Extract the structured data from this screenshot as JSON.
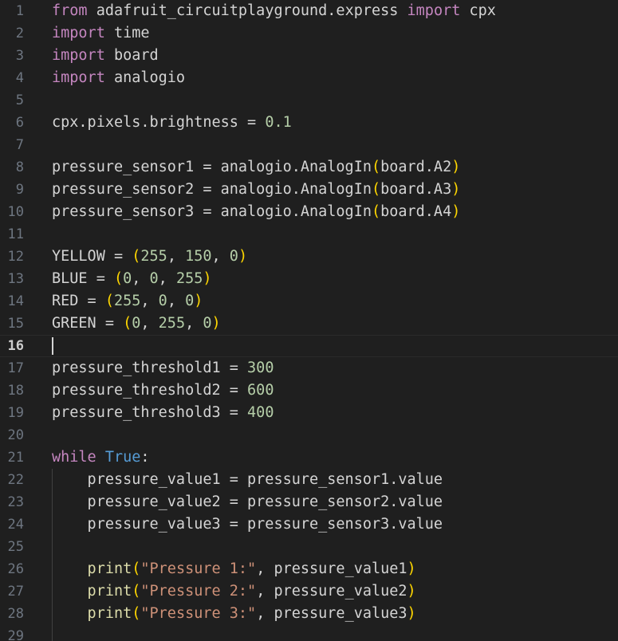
{
  "editor": {
    "language": "python",
    "current_line": 16,
    "lines": [
      {
        "n": "1",
        "tokens": [
          {
            "t": "from",
            "c": "t-kw"
          },
          {
            "t": " adafruit_circuitplayground.express ",
            "c": "t-var"
          },
          {
            "t": "import",
            "c": "t-kw"
          },
          {
            "t": " cpx",
            "c": "t-var"
          }
        ]
      },
      {
        "n": "2",
        "tokens": [
          {
            "t": "import",
            "c": "t-kw"
          },
          {
            "t": " time",
            "c": "t-var"
          }
        ]
      },
      {
        "n": "3",
        "tokens": [
          {
            "t": "import",
            "c": "t-kw"
          },
          {
            "t": " board",
            "c": "t-var"
          }
        ]
      },
      {
        "n": "4",
        "tokens": [
          {
            "t": "import",
            "c": "t-kw"
          },
          {
            "t": " analogio",
            "c": "t-var"
          }
        ]
      },
      {
        "n": "5",
        "tokens": []
      },
      {
        "n": "6",
        "tokens": [
          {
            "t": "cpx.pixels.brightness = ",
            "c": "t-var"
          },
          {
            "t": "0.1",
            "c": "t-num"
          }
        ]
      },
      {
        "n": "7",
        "tokens": []
      },
      {
        "n": "8",
        "tokens": [
          {
            "t": "pressure_sensor1 = analogio.AnalogIn",
            "c": "t-var"
          },
          {
            "t": "(",
            "c": "t-p1"
          },
          {
            "t": "board.A2",
            "c": "t-var"
          },
          {
            "t": ")",
            "c": "t-p1"
          }
        ]
      },
      {
        "n": "9",
        "tokens": [
          {
            "t": "pressure_sensor2 = analogio.AnalogIn",
            "c": "t-var"
          },
          {
            "t": "(",
            "c": "t-p1"
          },
          {
            "t": "board.A3",
            "c": "t-var"
          },
          {
            "t": ")",
            "c": "t-p1"
          }
        ]
      },
      {
        "n": "10",
        "tokens": [
          {
            "t": "pressure_sensor3 = analogio.AnalogIn",
            "c": "t-var"
          },
          {
            "t": "(",
            "c": "t-p1"
          },
          {
            "t": "board.A4",
            "c": "t-var"
          },
          {
            "t": ")",
            "c": "t-p1"
          }
        ]
      },
      {
        "n": "11",
        "tokens": []
      },
      {
        "n": "12",
        "tokens": [
          {
            "t": "YELLOW = ",
            "c": "t-var"
          },
          {
            "t": "(",
            "c": "t-p1"
          },
          {
            "t": "255",
            "c": "t-num"
          },
          {
            "t": ", ",
            "c": "t-var"
          },
          {
            "t": "150",
            "c": "t-num"
          },
          {
            "t": ", ",
            "c": "t-var"
          },
          {
            "t": "0",
            "c": "t-num"
          },
          {
            "t": ")",
            "c": "t-p1"
          }
        ]
      },
      {
        "n": "13",
        "tokens": [
          {
            "t": "BLUE = ",
            "c": "t-var"
          },
          {
            "t": "(",
            "c": "t-p1"
          },
          {
            "t": "0",
            "c": "t-num"
          },
          {
            "t": ", ",
            "c": "t-var"
          },
          {
            "t": "0",
            "c": "t-num"
          },
          {
            "t": ", ",
            "c": "t-var"
          },
          {
            "t": "255",
            "c": "t-num"
          },
          {
            "t": ")",
            "c": "t-p1"
          }
        ]
      },
      {
        "n": "14",
        "tokens": [
          {
            "t": "RED = ",
            "c": "t-var"
          },
          {
            "t": "(",
            "c": "t-p1"
          },
          {
            "t": "255",
            "c": "t-num"
          },
          {
            "t": ", ",
            "c": "t-var"
          },
          {
            "t": "0",
            "c": "t-num"
          },
          {
            "t": ", ",
            "c": "t-var"
          },
          {
            "t": "0",
            "c": "t-num"
          },
          {
            "t": ")",
            "c": "t-p1"
          }
        ]
      },
      {
        "n": "15",
        "tokens": [
          {
            "t": "GREEN = ",
            "c": "t-var"
          },
          {
            "t": "(",
            "c": "t-p1"
          },
          {
            "t": "0",
            "c": "t-num"
          },
          {
            "t": ", ",
            "c": "t-var"
          },
          {
            "t": "255",
            "c": "t-num"
          },
          {
            "t": ", ",
            "c": "t-var"
          },
          {
            "t": "0",
            "c": "t-num"
          },
          {
            "t": ")",
            "c": "t-p1"
          }
        ]
      },
      {
        "n": "16",
        "tokens": [],
        "cursor": true
      },
      {
        "n": "17",
        "tokens": [
          {
            "t": "pressure_threshold1 = ",
            "c": "t-var"
          },
          {
            "t": "300",
            "c": "t-num"
          }
        ]
      },
      {
        "n": "18",
        "tokens": [
          {
            "t": "pressure_threshold2 = ",
            "c": "t-var"
          },
          {
            "t": "600",
            "c": "t-num"
          }
        ]
      },
      {
        "n": "19",
        "tokens": [
          {
            "t": "pressure_threshold3 = ",
            "c": "t-var"
          },
          {
            "t": "400",
            "c": "t-num"
          }
        ]
      },
      {
        "n": "20",
        "tokens": []
      },
      {
        "n": "21",
        "tokens": [
          {
            "t": "while",
            "c": "t-ctl"
          },
          {
            "t": " ",
            "c": "t-var"
          },
          {
            "t": "True",
            "c": "t-const"
          },
          {
            "t": ":",
            "c": "t-var"
          }
        ]
      },
      {
        "n": "22",
        "indent": true,
        "tokens": [
          {
            "t": "    pressure_value1 = pressure_sensor1.value",
            "c": "t-var"
          }
        ]
      },
      {
        "n": "23",
        "indent": true,
        "tokens": [
          {
            "t": "    pressure_value2 = pressure_sensor2.value",
            "c": "t-var"
          }
        ]
      },
      {
        "n": "24",
        "indent": true,
        "tokens": [
          {
            "t": "    pressure_value3 = pressure_sensor3.value",
            "c": "t-var"
          }
        ]
      },
      {
        "n": "25",
        "indent": true,
        "tokens": []
      },
      {
        "n": "26",
        "indent": true,
        "tokens": [
          {
            "t": "    print",
            "c": "t-fn"
          },
          {
            "t": "(",
            "c": "t-p1"
          },
          {
            "t": "\"Pressure 1:\"",
            "c": "t-str"
          },
          {
            "t": ", pressure_value1",
            "c": "t-var"
          },
          {
            "t": ")",
            "c": "t-p1"
          }
        ]
      },
      {
        "n": "27",
        "indent": true,
        "tokens": [
          {
            "t": "    print",
            "c": "t-fn"
          },
          {
            "t": "(",
            "c": "t-p1"
          },
          {
            "t": "\"Pressure 2:\"",
            "c": "t-str"
          },
          {
            "t": ", pressure_value2",
            "c": "t-var"
          },
          {
            "t": ")",
            "c": "t-p1"
          }
        ]
      },
      {
        "n": "28",
        "indent": true,
        "tokens": [
          {
            "t": "    print",
            "c": "t-fn"
          },
          {
            "t": "(",
            "c": "t-p1"
          },
          {
            "t": "\"Pressure 3:\"",
            "c": "t-str"
          },
          {
            "t": ", pressure_value3",
            "c": "t-var"
          },
          {
            "t": ")",
            "c": "t-p1"
          }
        ]
      },
      {
        "n": "29",
        "indent": true,
        "tokens": []
      }
    ]
  },
  "colors": {
    "background": "#1f1f1f",
    "keyword": "#c586c0",
    "constant": "#569cd6",
    "number": "#b5cea8",
    "string": "#ce9178",
    "function": "#dcdcaa",
    "bracket": "#ffd700",
    "line_number": "#6e7681"
  }
}
